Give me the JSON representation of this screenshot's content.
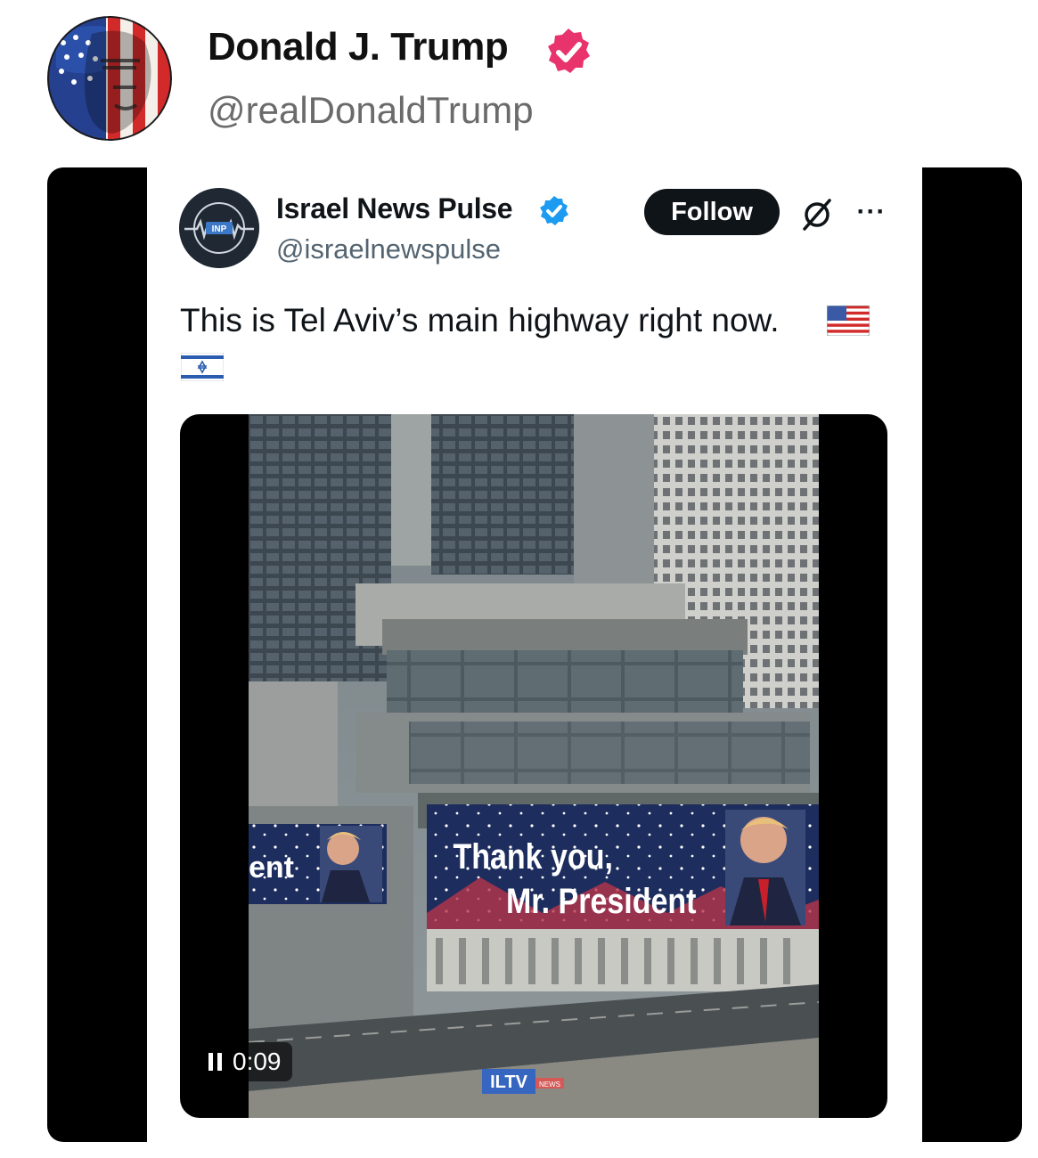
{
  "post": {
    "author_name": "Donald J. Trump",
    "author_handle": "@realDonaldTrump",
    "verified_color": "#e8336c"
  },
  "embed": {
    "author_name": "Israel News Pulse",
    "author_handle": "@israelnewspulse",
    "follow_label": "Follow",
    "more_label": "···",
    "text": "This is Tel Aviv’s main highway right now.",
    "emojis": [
      "flag-us-icon",
      "flag-il-icon"
    ],
    "verified_color": "#1d9bf0",
    "avatar_logo_text": "INP"
  },
  "video": {
    "duration": "0:09",
    "billboard_main_line1": "Thank you,",
    "billboard_main_line2": "Mr. President",
    "billboard_left_fragment": "ent",
    "watermark": "ILTV",
    "watermark_sub": "NEWS"
  }
}
